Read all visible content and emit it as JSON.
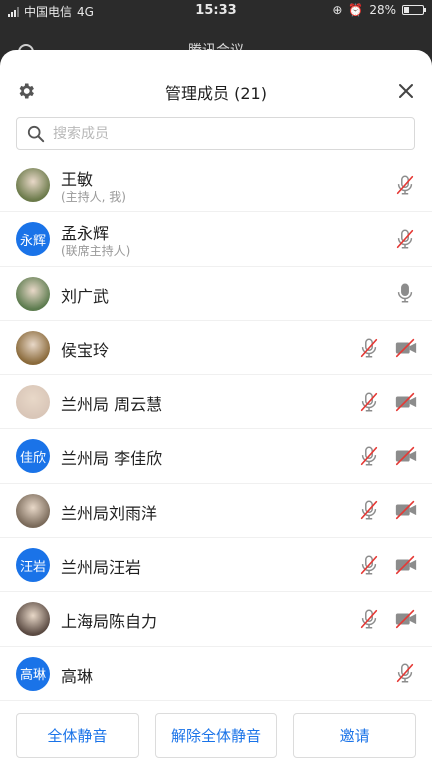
{
  "statusbar": {
    "carrier": "中国电信",
    "network": "4G",
    "time": "15:33",
    "battery": "28%"
  },
  "background": {
    "title": "腾讯会议"
  },
  "sheet": {
    "title": "管理成员 (21)",
    "search_placeholder": "搜索成员"
  },
  "members": [
    {
      "name": "王敏",
      "sub": "(主持人, 我)",
      "avatar": "photo",
      "avatar_color": "#6b7a4a",
      "mic": "muted",
      "camera": "none"
    },
    {
      "name": "孟永辉",
      "sub": "(联席主持人)",
      "avatar": "text",
      "avatar_text": "永辉",
      "mic": "muted",
      "camera": "none"
    },
    {
      "name": "刘广武",
      "sub": "",
      "avatar": "photo",
      "avatar_color": "#5c7b4e",
      "mic": "on",
      "camera": "none"
    },
    {
      "name": "侯宝玲",
      "sub": "",
      "avatar": "photo",
      "avatar_color": "#8a6a3b",
      "mic": "muted",
      "camera": "off"
    },
    {
      "name": "兰州局   周云慧",
      "sub": "",
      "avatar": "photo",
      "avatar_color": "#d9c6b8",
      "mic": "muted",
      "camera": "off"
    },
    {
      "name": "兰州局 李佳欣",
      "sub": "",
      "avatar": "text",
      "avatar_text": "佳欣",
      "mic": "muted",
      "camera": "off"
    },
    {
      "name": "兰州局刘雨洋",
      "sub": "",
      "avatar": "photo",
      "avatar_color": "#7a6a5a",
      "mic": "muted",
      "camera": "off"
    },
    {
      "name": "兰州局汪岩",
      "sub": "",
      "avatar": "text",
      "avatar_text": "汪岩",
      "mic": "muted",
      "camera": "off"
    },
    {
      "name": "上海局陈自力",
      "sub": "",
      "avatar": "photo",
      "avatar_color": "#5a4a42",
      "mic": "muted",
      "camera": "off"
    },
    {
      "name": "高琳",
      "sub": "",
      "avatar": "text",
      "avatar_text": "高琳",
      "mic": "muted",
      "camera": "none"
    }
  ],
  "footer": {
    "mute_all": "全体静音",
    "unmute_all": "解除全体静音",
    "invite": "邀请"
  },
  "colors": {
    "accent": "#1a73e8",
    "muted_red": "#e53935",
    "icon_gray": "#8c8c8c"
  }
}
